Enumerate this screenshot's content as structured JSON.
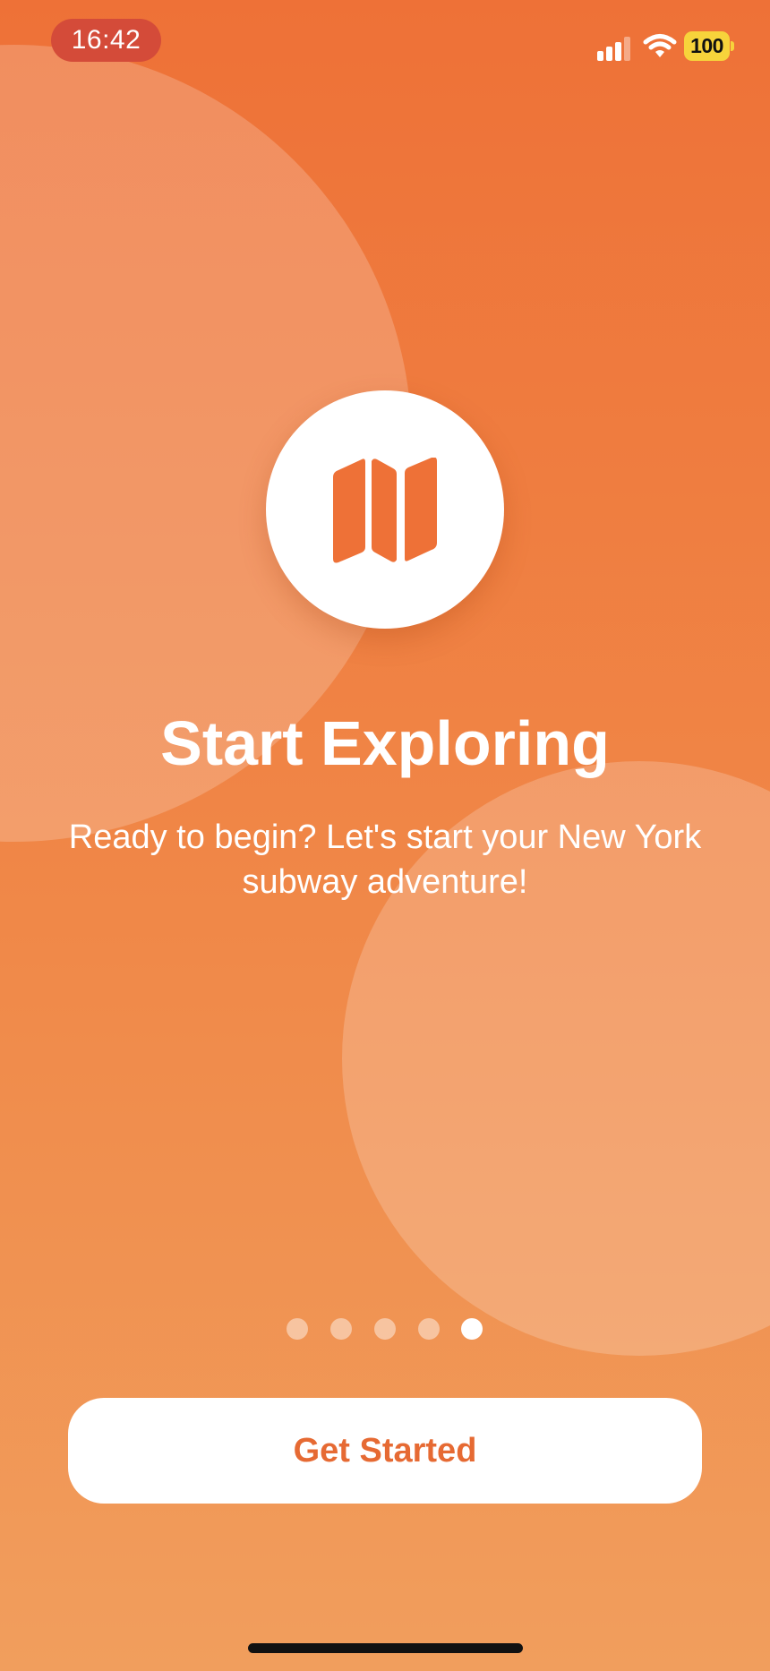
{
  "status_bar": {
    "time": "16:42",
    "battery_level": "100",
    "signal_icon": "cellular-signal-icon",
    "wifi_icon": "wifi-icon",
    "battery_icon": "battery-icon"
  },
  "hero": {
    "icon": "map-icon",
    "title": "Start Exploring",
    "subtitle": "Ready to begin? Let's start your New York subway adventure!"
  },
  "pagination": {
    "total_pages": 5,
    "current_page": 5
  },
  "cta": {
    "label": "Get Started"
  },
  "colors": {
    "background_top": "#EE7137",
    "background_bottom": "#F19E5D",
    "accent": "#E66A33",
    "time_pill": "#D44B39",
    "battery": "#F7D33B"
  }
}
